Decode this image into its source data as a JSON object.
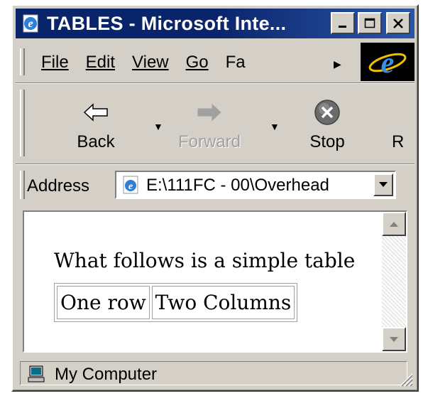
{
  "window": {
    "title": "TABLES - Microsoft Inte...",
    "title_icon": "ie-page-icon",
    "controls": [
      "minimize-icon",
      "maximize-icon",
      "close-icon"
    ]
  },
  "menubar": {
    "items": [
      "File",
      "Edit",
      "View",
      "Go",
      "Fa"
    ],
    "more_icon": "chevron-right-icon",
    "brand_icon": "ie-logo-icon"
  },
  "toolbar": {
    "back_label": "Back",
    "forward_label": "Forward",
    "stop_label": "Stop",
    "refresh_label_partial": "R"
  },
  "address": {
    "label": "Address",
    "value": "E:\\111FC - 00\\Overhead"
  },
  "page": {
    "intro_text": "What follows is a simple table",
    "table": [
      [
        "One row",
        "Two Columns"
      ]
    ]
  },
  "statusbar": {
    "zone_text": "My Computer",
    "zone_icon": "computer-icon"
  },
  "colors": {
    "titlebar": "#0a246a",
    "chrome": "#d4d0c8"
  }
}
